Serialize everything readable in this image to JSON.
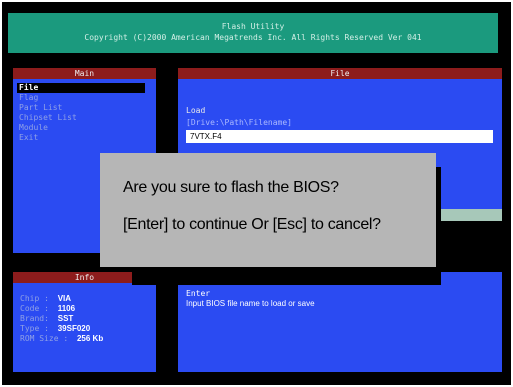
{
  "header": {
    "title": "Flash Utility",
    "copyright": "Copyright (C)2000 American Megatrends Inc. All Rights Reserved Ver 041"
  },
  "main_panel": {
    "title": "Main",
    "items": [
      {
        "label": "File",
        "selected": true
      },
      {
        "label": "Flag",
        "selected": false
      },
      {
        "label": "Part List",
        "selected": false
      },
      {
        "label": "Chipset List",
        "selected": false
      },
      {
        "label": "Module",
        "selected": false
      },
      {
        "label": "Exit",
        "selected": false
      }
    ]
  },
  "file_panel": {
    "title": "File",
    "load_label": "Load",
    "path_hint": "[Drive:\\Path\\Filename]",
    "path_value": "7VTX.F4"
  },
  "info_panel": {
    "title": "Info",
    "rows": [
      {
        "label": "Chip",
        "value": "VIA"
      },
      {
        "label": "Code",
        "value": "1106"
      },
      {
        "label": "Brand",
        "value": "SST"
      },
      {
        "label": "Type",
        "value": "39SF020"
      },
      {
        "label": "ROM Size",
        "value": "256 Kb"
      }
    ]
  },
  "message_panel": {
    "title": "Enter",
    "text": "Input BIOS file name to load or save"
  },
  "dialog": {
    "line1": "Are you sure to flash the BIOS?",
    "line2": "[Enter] to continue Or [Esc] to cancel?"
  },
  "colors": {
    "background": "#000000",
    "header": "#1b9a7e",
    "panel": "#2b4bf2",
    "panel_title": "#8d1c1c",
    "dialog": "#b6b6b6"
  }
}
